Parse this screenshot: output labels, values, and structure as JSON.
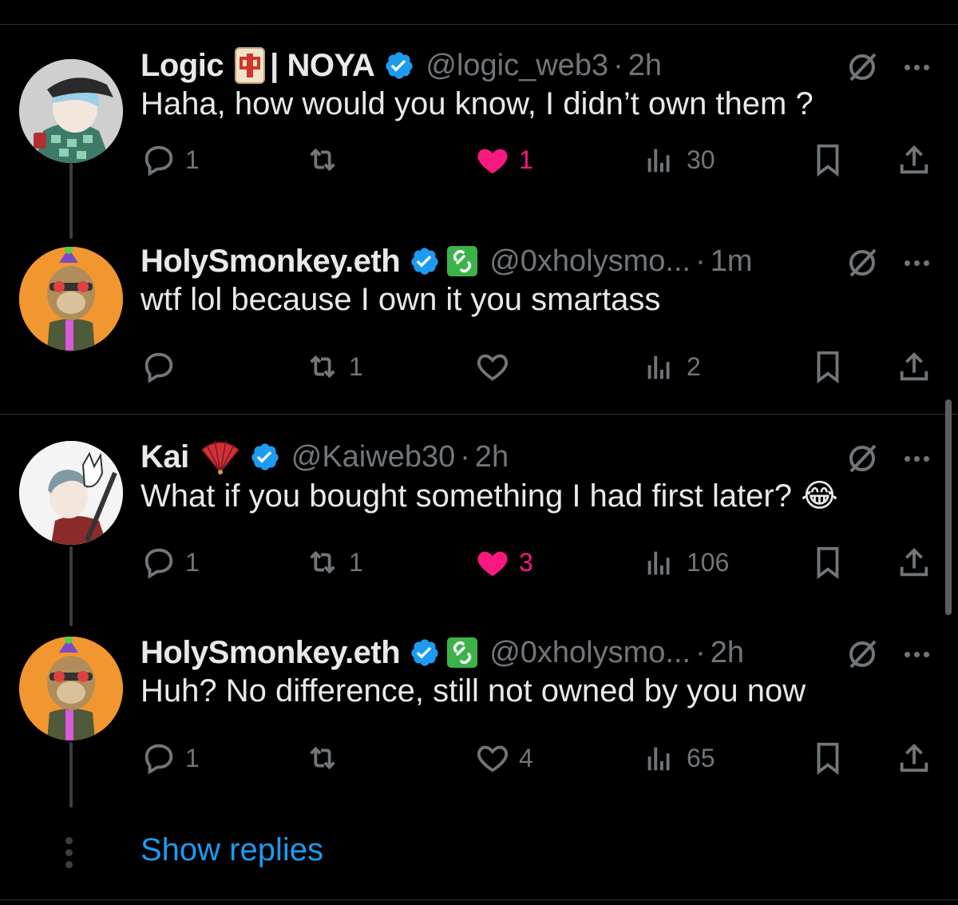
{
  "colors": {
    "background": "#000000",
    "text": "#e7e9ea",
    "muted": "#71767b",
    "like_active": "#f91880",
    "verified": "#1d9bf0",
    "link": "#1d9bf0"
  },
  "tweets": [
    {
      "name": "Logic",
      "name_suffix": "| NOYA",
      "name_emoji": "🀄",
      "verified": true,
      "handle": "@logic_web3",
      "separator": "·",
      "time": "2h",
      "text": "Haha, how would you know, I didn’t own them ?",
      "replies": "1",
      "retweets": "",
      "likes": "1",
      "liked": true,
      "views": "30",
      "avatar": "anime-avatar-cap"
    },
    {
      "name": "HolySmonkey.eth",
      "verified": true,
      "extra_badge": "link-badge-icon",
      "handle": "@0xholysmo...",
      "separator": "·",
      "time": "1m",
      "text": "wtf lol because I own it you smartass",
      "replies": "",
      "retweets": "1",
      "likes": "",
      "liked": false,
      "views": "2",
      "avatar": "ape-avatar"
    },
    {
      "name": "Kai",
      "name_emoji": "🪭",
      "verified": true,
      "handle": "@Kaiweb30",
      "separator": "·",
      "time": "2h",
      "text": "What if you bought something I had first later? 😂",
      "replies": "1",
      "retweets": "1",
      "likes": "3",
      "liked": true,
      "views": "106",
      "avatar": "anime-avatar-mask"
    },
    {
      "name": "HolySmonkey.eth",
      "verified": true,
      "extra_badge": "link-badge-icon",
      "handle": "@0xholysmo...",
      "separator": "·",
      "time": "2h",
      "text": "Huh? No difference, still not owned by you now",
      "replies": "1",
      "retweets": "",
      "likes": "4",
      "liked": false,
      "views": "65",
      "avatar": "ape-avatar"
    }
  ],
  "show_replies": "Show replies"
}
